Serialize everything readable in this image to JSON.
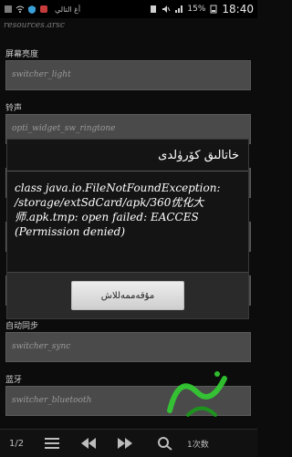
{
  "statusbar": {
    "notification_text": "أغ التالي",
    "battery": "15%",
    "time": "18:40"
  },
  "header": {
    "filename": "resources.arsc"
  },
  "rows": [
    {
      "label": "屏幕亮度",
      "value": "switcher_light"
    },
    {
      "label": "铃声",
      "value": "opti_widget_sw_ringtone"
    },
    {
      "label": "自动同步",
      "value": "switcher_sync"
    },
    {
      "label": "蓝牙",
      "value": "switcher_bluetooth"
    }
  ],
  "dialog": {
    "title": "خاتالىق كۆرۈلدى",
    "message": "class java.io.FileNotFoundException: /storage/extSdCard/apk/360优化大师.apk.tmp: open failed: EACCES (Permission denied)",
    "button_label": "مۇقەممەللاش"
  },
  "bottombar": {
    "page_indicator": "1/2",
    "search_text": "1次数"
  }
}
